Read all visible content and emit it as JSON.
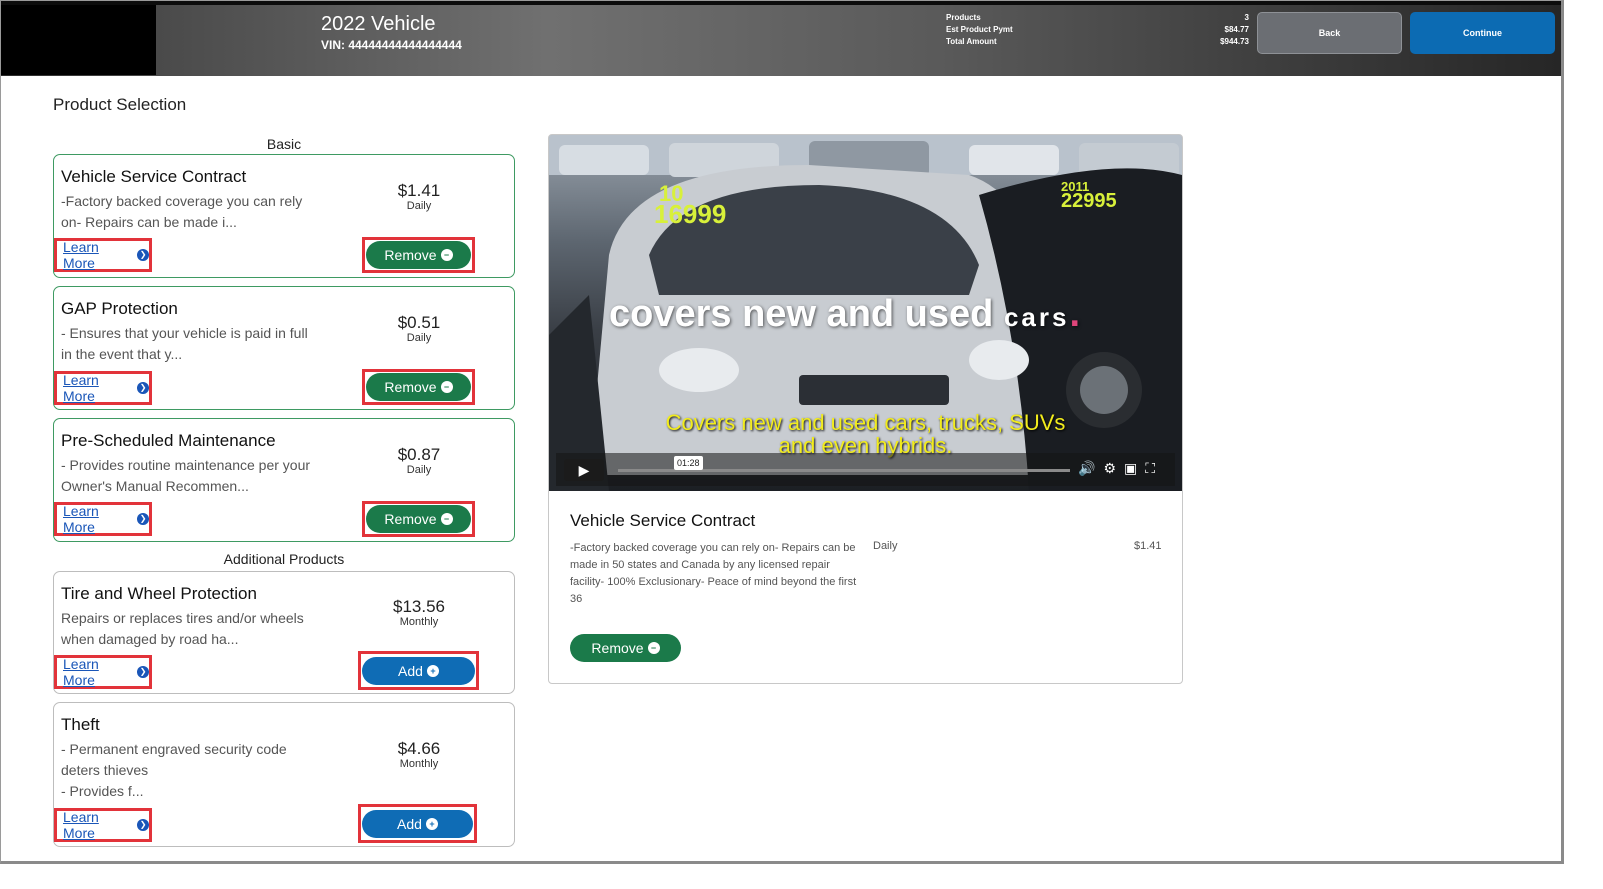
{
  "header": {
    "vehicle_title": "2022 Vehicle",
    "vin": "VIN: 44444444444444444",
    "summary_labels": [
      "Products",
      "Est Product Pymt",
      "Total Amount"
    ],
    "summary_values": [
      "3",
      "$84.77",
      "$944.73"
    ],
    "back_label": "Back",
    "continue_label": "Continue"
  },
  "page": {
    "title": "Product Selection",
    "groups": {
      "basic": "Basic",
      "additional": "Additional Products"
    }
  },
  "products": [
    {
      "name": "Vehicle Service Contract",
      "desc_line1": "-Factory backed coverage you can rely",
      "desc_line2": "on- Repairs can be made i...",
      "price": "$1.41",
      "period": "Daily",
      "learn": "Learn More",
      "action": "Remove"
    },
    {
      "name": "GAP Protection",
      "desc_line1": "- Ensures that your vehicle is paid in full",
      "desc_line2": "in the event that y...",
      "price": "$0.51",
      "period": "Daily",
      "learn": "Learn More",
      "action": "Remove"
    },
    {
      "name": "Pre-Scheduled Maintenance",
      "desc_line1": "- Provides routine maintenance per your",
      "desc_line2": "Owner's Manual Recommen...",
      "price": "$0.87",
      "period": "Daily",
      "learn": "Learn More",
      "action": "Remove"
    },
    {
      "name": "Tire and Wheel Protection",
      "desc_line1": "Repairs or replaces tires and/or wheels",
      "desc_line2": "when damaged by road ha...",
      "price": "$13.56",
      "period": "Monthly",
      "learn": "Learn More",
      "action": "Add"
    },
    {
      "name": "Theft",
      "desc_line1": "- Permanent engraved security code",
      "desc_line2": "deters thieves",
      "desc_line3": "- Provides f...",
      "price": "$4.66",
      "period": "Monthly",
      "learn": "Learn More",
      "action": "Add"
    }
  ],
  "video": {
    "headline_big": "covers new and used",
    "headline_small": "cars",
    "headline_dot": ".",
    "price_tag_left_1": "10",
    "price_tag_left_2": "16999",
    "price_tag_right_1": "2011",
    "price_tag_right_2": "22995",
    "caption_line1": "Covers new and used cars, trucks, SUVs",
    "caption_line2": "and even hybrids.",
    "time": "01:28",
    "play_icon": "play-icon",
    "control_icons": [
      "volume-icon",
      "gear-icon",
      "pip-icon",
      "fullscreen-icon"
    ]
  },
  "detail": {
    "name": "Vehicle Service Contract",
    "desc": "-Factory backed coverage you can rely on- Repairs can be made in 50 states and Canada by any licensed repair facility- 100% Exclusionary- Peace of mind beyond the first 36",
    "period": "Daily",
    "price": "$1.41",
    "action": "Remove"
  },
  "colors": {
    "remove_green": "#1b7a4a",
    "add_blue": "#0f6cb5",
    "continue_blue": "#0c6bb3",
    "highlight_red": "#e2333a",
    "selected_border": "#3e9a62"
  }
}
